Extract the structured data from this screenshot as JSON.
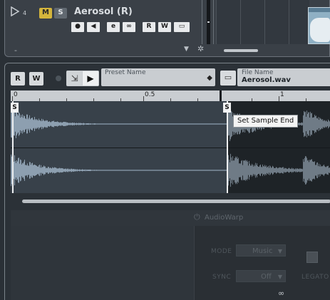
{
  "track": {
    "number": "4",
    "mute_label": "M",
    "solo_label": "S",
    "name": "Aerosol (R)",
    "buttons": [
      {
        "label": "●",
        "name": "record-enable-button"
      },
      {
        "label": "◀",
        "name": "monitor-button"
      },
      {
        "label": "e",
        "name": "edit-channel-button"
      },
      {
        "label": "∞",
        "name": "link-button"
      },
      {
        "label": "R",
        "name": "read-automation-button"
      },
      {
        "label": "W",
        "name": "write-automation-button"
      },
      {
        "label": "▭",
        "name": "lane-button"
      }
    ],
    "minus": "-"
  },
  "editor": {
    "read_label": "R",
    "write_label": "W",
    "preset_label": "Preset Name",
    "preset_value": "",
    "file_label": "File Name",
    "file_value": "Aerosol.wav",
    "ruler": {
      "labels": [
        "0",
        "0.5",
        "1"
      ]
    },
    "start_marker": "S",
    "end_marker": "S",
    "tooltip": "Set Sample End"
  },
  "audiowarp": {
    "title": "AudioWarp",
    "mode_label": "MODE",
    "mode_value": "Music",
    "sync_label": "SYNC",
    "sync_value": "Off",
    "legato_label": "LEGATO"
  },
  "colors": {
    "mute_active": "#d4b53c",
    "waveform": "#8d9fb0",
    "selection_bg": "#1e2327"
  }
}
